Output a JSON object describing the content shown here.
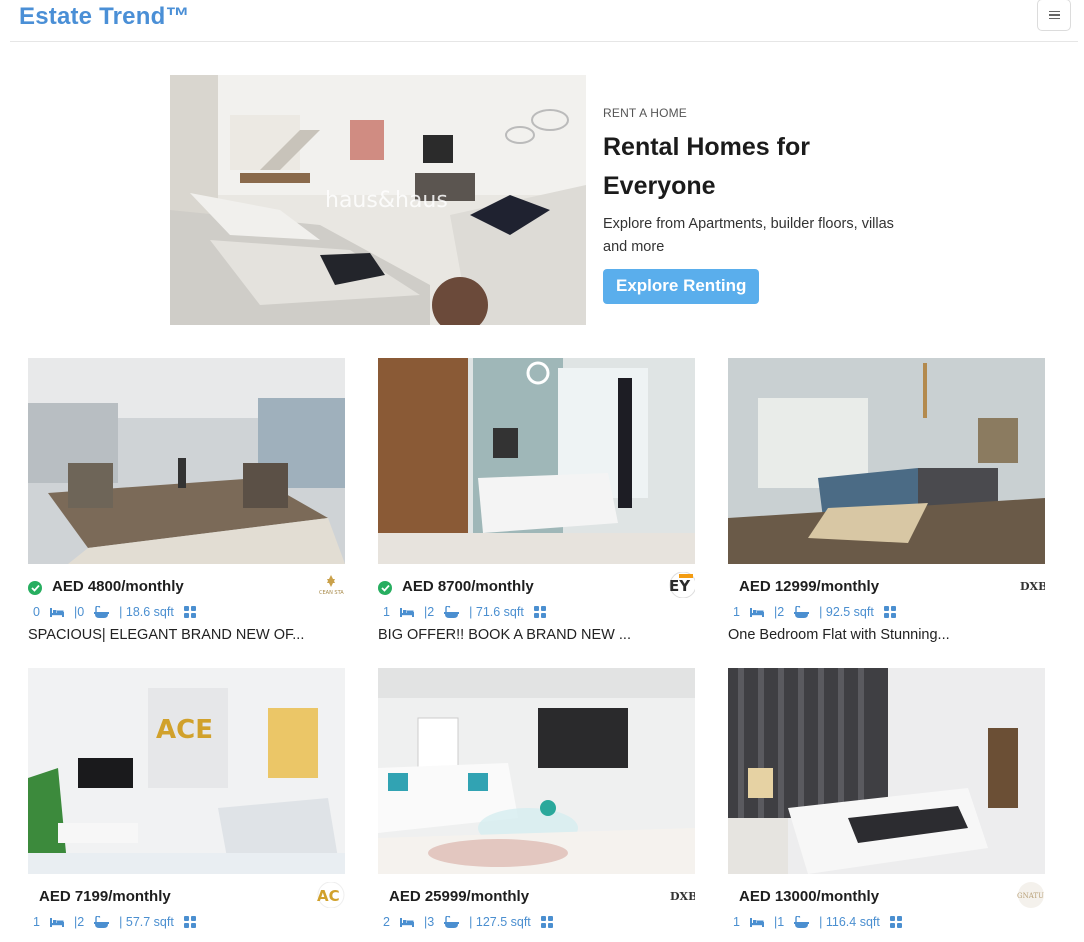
{
  "header": {
    "brand": "Estate Trend™",
    "menu_icon": "hamburger-icon"
  },
  "hero": {
    "eyebrow": "RENT A HOME",
    "title_line1": "Rental Homes for",
    "title_line2": "Everyone",
    "description": "Explore from Apartments, builder floors, villas and more",
    "cta_label": "Explore Renting",
    "image_watermark": "haus&haus"
  },
  "listings": [
    {
      "verified": true,
      "price": "AED 4800/monthly",
      "beds": "0",
      "baths": "|0",
      "area": "| 18.6 sqft",
      "title": "SPACIOUS| ELEGANT BRAND NEW OF...",
      "agency_logo": "CEAN STAR",
      "photo": "office"
    },
    {
      "verified": true,
      "price": "AED 8700/monthly",
      "beds": "1",
      "baths": "|2",
      "area": "| 71.6 sqft",
      "title": "BIG OFFER!! BOOK A BRAND NEW ...",
      "agency_logo": "EY",
      "photo": "bedroom-wood"
    },
    {
      "verified": false,
      "price": "AED 12999/monthly",
      "beds": "1",
      "baths": "|2",
      "area": "| 92.5 sqft",
      "title": "One Bedroom Flat with Stunning...",
      "agency_logo": "DXB",
      "photo": "living-blue"
    },
    {
      "verified": false,
      "price": "AED 7199/monthly",
      "beds": "1",
      "baths": "|2",
      "area": "| 57.7 sqft",
      "title": "",
      "agency_logo": "ACE",
      "photo": "living-ace"
    },
    {
      "verified": false,
      "price": "AED 25999/monthly",
      "beds": "2",
      "baths": "|3",
      "area": "| 127.5 sqft",
      "title": "",
      "agency_logo": "DXB",
      "photo": "living-white"
    },
    {
      "verified": false,
      "price": "AED 13000/monthly",
      "beds": "1",
      "baths": "|1",
      "area": "| 116.4 sqft",
      "title": "",
      "agency_logo": "SIGNATURE",
      "photo": "bedroom-dark"
    }
  ],
  "colors": {
    "brand": "#4a8fd6",
    "cta": "#5aaeec",
    "stat_icons": "#4b8fd0",
    "verified": "#27ae60"
  }
}
